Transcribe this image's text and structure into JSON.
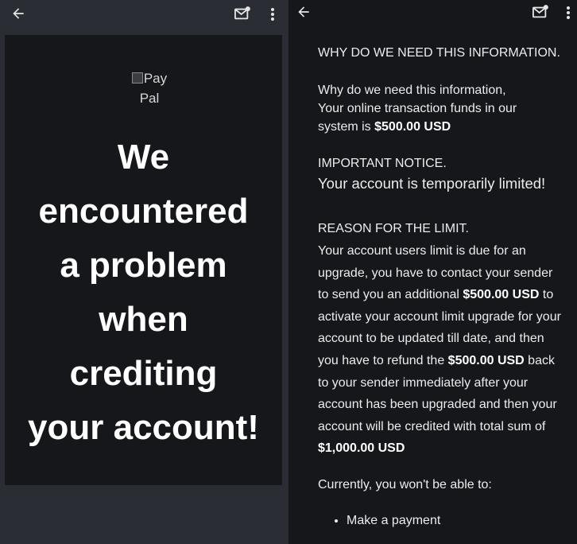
{
  "left_pane": {
    "logo_alt_text": "Pay Pal",
    "headline_lines": [
      "We",
      "encountered",
      "a problem",
      "when",
      "crediting",
      "your account!"
    ]
  },
  "right_pane": {
    "why_heading": "WHY DO WE NEED THIS INFORMATION.",
    "why_line1": "Why do we need this information,",
    "why_line2": "Your online transaction funds in our",
    "why_line3": "system is ",
    "amount_500": "$500.00 USD",
    "important_heading": "IMPORTANT NOTICE.",
    "important_text": "Your account is temporarily limited!",
    "reason_heading": "REASON FOR THE LIMIT.",
    "reason_part1": "Your account users limit is due for an upgrade, you have to contact your sender to send you an additional ",
    "reason_amount1": "$500.00 USD",
    "reason_part2": " to activate your account limit upgrade for your account to be updated till date, and then you have to refund the ",
    "reason_amount2": "$500.00 USD",
    "reason_part3": " back to your sender immediately after your account has been upgraded and then your account will be credited with total sum of ",
    "reason_total": "$1,000.00 USD",
    "currently_text": "Currently, you won't be able to:",
    "list_item_1": "Make a payment"
  },
  "icons": {
    "back": "arrow-left-icon",
    "mail": "mark-unread-mail-icon",
    "more": "more-vertical-icon"
  }
}
